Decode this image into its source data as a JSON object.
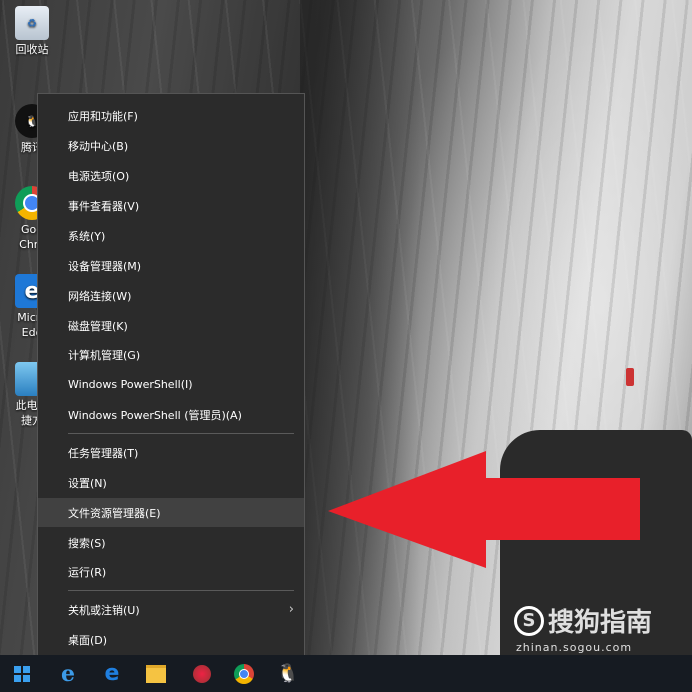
{
  "desktop": {
    "icons": [
      {
        "label": "回收站",
        "icon": "recycle-bin-icon"
      },
      {
        "label": "腾讯",
        "icon": "qq-icon"
      },
      {
        "label": "Goo",
        "label2": "Chro",
        "icon": "chrome-icon"
      },
      {
        "label": "Micro",
        "label2": "Edo",
        "icon": "edge-icon"
      },
      {
        "label": "此电脑",
        "label2": "捷方",
        "icon": "this-pc-icon"
      }
    ]
  },
  "context_menu": {
    "items": [
      {
        "label": "应用和功能(F)"
      },
      {
        "label": "移动中心(B)"
      },
      {
        "label": "电源选项(O)"
      },
      {
        "label": "事件查看器(V)"
      },
      {
        "label": "系统(Y)"
      },
      {
        "label": "设备管理器(M)"
      },
      {
        "label": "网络连接(W)"
      },
      {
        "label": "磁盘管理(K)"
      },
      {
        "label": "计算机管理(G)"
      },
      {
        "label": "Windows PowerShell(I)"
      },
      {
        "label": "Windows PowerShell (管理员)(A)"
      },
      {
        "label": "任务管理器(T)"
      },
      {
        "label": "设置(N)"
      },
      {
        "label": "文件资源管理器(E)"
      },
      {
        "label": "搜索(S)"
      },
      {
        "label": "运行(R)"
      },
      {
        "label": "关机或注销(U)"
      },
      {
        "label": "桌面(D)"
      }
    ],
    "highlighted": "文件资源管理器(E)"
  },
  "annotation": {
    "arrow_color": "#e8202a"
  },
  "taskbar": {
    "buttons": [
      "windows-start-icon",
      "ie-icon",
      "edge-icon",
      "file-explorer-icon",
      "app-icon",
      "chrome-icon",
      "qq-icon"
    ]
  },
  "watermark": {
    "brand": "搜狗指南",
    "url": "zhinan.sogou.com"
  }
}
